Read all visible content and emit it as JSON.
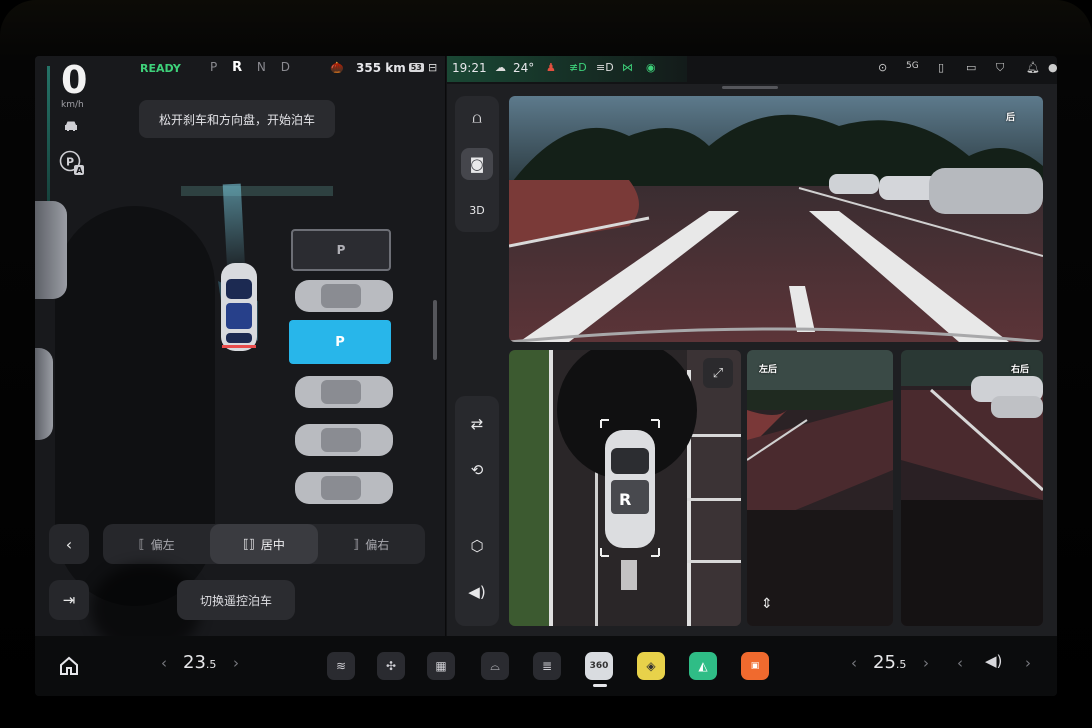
{
  "cluster": {
    "speed": "0",
    "speed_unit": "km/h",
    "status": "READY",
    "gears": [
      "P",
      "R",
      "N",
      "D"
    ],
    "active_gear": "R"
  },
  "status_bar": {
    "range": "355 km",
    "battery_tag": "53",
    "time": "19:21",
    "temperature": "24°",
    "icons": [
      "avatar-icon",
      "battery-icon",
      "weather-icon",
      "seatbelt-icon",
      "headlight-icon",
      "beam-icon",
      "fog-icon",
      "tpms-icon",
      "more-icon",
      "signal-icon",
      "phone-icon",
      "dashcam-icon",
      "shield-icon",
      "bell-icon",
      "user-icon"
    ]
  },
  "parking": {
    "hint": "松开刹车和方向盘，开始泊车",
    "slot_top_label": "P",
    "slot_selected_label": "P",
    "position_options": [
      {
        "label": "偏左",
        "active": false
      },
      {
        "label": "居中",
        "active": true
      },
      {
        "label": "偏右",
        "active": false
      }
    ],
    "remote_label": "切换遥控泊车"
  },
  "cameras": {
    "rear_label": "后",
    "left_rear_label": "左后",
    "right_rear_label": "右后",
    "topview_gear": "R"
  },
  "dock": {
    "left_temp_main": "23",
    "left_temp_decimal": ".5",
    "right_temp_main": "25",
    "right_temp_decimal": ".5",
    "apps": [
      "seat-heat-icon",
      "fan-icon",
      "rear-defrost-icon",
      "car-icon",
      "seat-vent-icon",
      "panorama-icon",
      "photos-icon",
      "maps-icon",
      "media-icon"
    ]
  },
  "colors": {
    "accent_blue": "#28b6ea",
    "ready_green": "#3ed17a"
  }
}
